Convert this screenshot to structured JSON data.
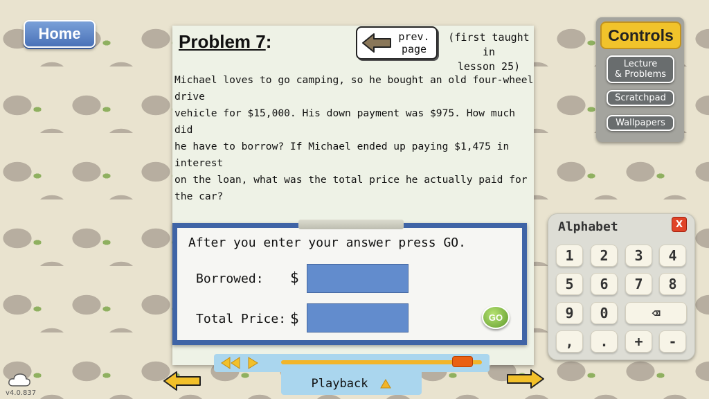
{
  "nav": {
    "home_label": "Home"
  },
  "problem": {
    "title": "Problem 7",
    "title_suffix": ":",
    "prev_page_line1": "prev.",
    "prev_page_line2": "page",
    "first_taught_line1": "(first taught in",
    "first_taught_line2": "lesson 25)",
    "lines": [
      "Michael loves to go camping, so he bought an old four-wheel drive",
      "vehicle for $15,000. His down payment was $975. How much did",
      "he have to borrow? If Michael ended up paying $1,475 in interest",
      "on the loan, what was the total price he actually paid for the car?"
    ]
  },
  "answer": {
    "instruction": "After you enter your answer press GO.",
    "fields": [
      {
        "label": "Borrowed:",
        "currency": "$",
        "value": ""
      },
      {
        "label": "Total Price:",
        "currency": "$",
        "value": ""
      }
    ],
    "go_label": "GO"
  },
  "controls": {
    "title": "Controls",
    "lecture_line1": "Lecture",
    "lecture_line2": "& Problems",
    "scratchpad": "Scratchpad",
    "wallpapers": "Wallpapers"
  },
  "keypad": {
    "alphabet_label": "Alphabet",
    "close_label": "X",
    "rows": [
      [
        "1",
        "2",
        "3",
        "4"
      ],
      [
        "5",
        "6",
        "7",
        "8"
      ],
      [
        "9",
        "0",
        "⌫"
      ],
      [
        ",",
        ".",
        "+",
        "-"
      ]
    ]
  },
  "playback": {
    "label": "Playback",
    "progress": 0.95
  },
  "footer": {
    "version": "v4.0.837"
  },
  "colors": {
    "accent_blue": "#3f64a6",
    "answer_field": "#628ccd",
    "controls_yellow": "#f1c32b",
    "go_green": "#6aa934",
    "timeline": "#aad6ee"
  }
}
